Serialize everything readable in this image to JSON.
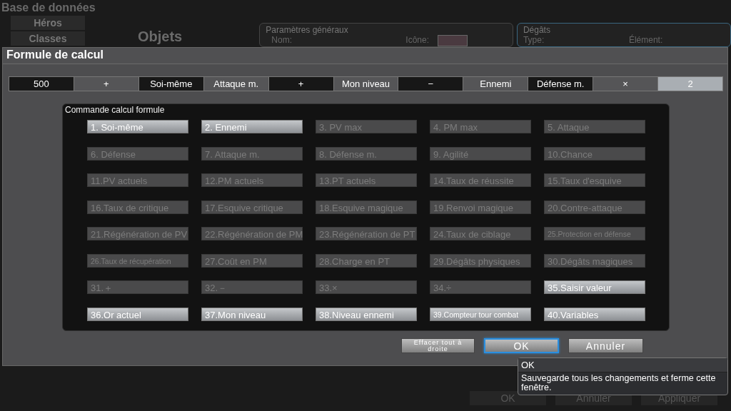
{
  "background": {
    "title": "Base de données",
    "sidebar": [
      {
        "label": "Héros"
      },
      {
        "label": "Classes"
      }
    ],
    "heading": "Objets",
    "general_panel": {
      "title": "Paramètres généraux",
      "name_label": "Nom:",
      "icon_label": "Icône:"
    },
    "damage_panel": {
      "title": "Dégâts",
      "type_label": "Type:",
      "element_label": "Élément:"
    },
    "buttons": [
      "OK",
      "Annuler",
      "Appliquer"
    ]
  },
  "dialog": {
    "title": "Formule de calcul",
    "formula": [
      {
        "text": "500",
        "selected": false
      },
      {
        "text": "+",
        "selected": false
      },
      {
        "text": "Soi-même",
        "selected": false
      },
      {
        "text": "Attaque m.",
        "selected": false
      },
      {
        "text": "+",
        "selected": false
      },
      {
        "text": "Mon niveau",
        "selected": false
      },
      {
        "text": "−",
        "selected": false
      },
      {
        "text": "Ennemi",
        "selected": false
      },
      {
        "text": "Défense m.",
        "selected": false
      },
      {
        "text": "×",
        "selected": false
      },
      {
        "text": "2",
        "selected": true
      }
    ],
    "commands": {
      "title": "Commande calcul formule",
      "items": [
        {
          "label": "1. Soi-même",
          "enabled": true,
          "small": false
        },
        {
          "label": "2. Ennemi",
          "enabled": true,
          "small": false
        },
        {
          "label": "3. PV max",
          "enabled": false,
          "small": false
        },
        {
          "label": "4. PM max",
          "enabled": false,
          "small": false
        },
        {
          "label": "5. Attaque",
          "enabled": false,
          "small": false
        },
        {
          "label": "6. Défense",
          "enabled": false,
          "small": false
        },
        {
          "label": "7. Attaque m.",
          "enabled": false,
          "small": false
        },
        {
          "label": "8. Défense m.",
          "enabled": false,
          "small": false
        },
        {
          "label": "9. Agilité",
          "enabled": false,
          "small": false
        },
        {
          "label": "10.Chance",
          "enabled": false,
          "small": false
        },
        {
          "label": "11.PV actuels",
          "enabled": false,
          "small": false
        },
        {
          "label": "12.PM actuels",
          "enabled": false,
          "small": false
        },
        {
          "label": "13.PT actuels",
          "enabled": false,
          "small": false
        },
        {
          "label": "14.Taux de réussite",
          "enabled": false,
          "small": false
        },
        {
          "label": "15.Taux d'esquive",
          "enabled": false,
          "small": false
        },
        {
          "label": "16.Taux de critique",
          "enabled": false,
          "small": false
        },
        {
          "label": "17.Esquive critique",
          "enabled": false,
          "small": false
        },
        {
          "label": "18.Esquive magique",
          "enabled": false,
          "small": false
        },
        {
          "label": "19.Renvoi magique",
          "enabled": false,
          "small": false
        },
        {
          "label": "20.Contre-attaque",
          "enabled": false,
          "small": false
        },
        {
          "label": "21.Régénération de PV",
          "enabled": false,
          "small": false
        },
        {
          "label": "22.Régénération de PM",
          "enabled": false,
          "small": false
        },
        {
          "label": "23.Régénération de PT",
          "enabled": false,
          "small": false
        },
        {
          "label": "24.Taux de ciblage",
          "enabled": false,
          "small": false
        },
        {
          "label": "25.Protection en défense",
          "enabled": false,
          "small": true
        },
        {
          "label": "26.Taux de récupération",
          "enabled": false,
          "small": true
        },
        {
          "label": "27.Coût en PM",
          "enabled": false,
          "small": false
        },
        {
          "label": "28.Charge en PT",
          "enabled": false,
          "small": false
        },
        {
          "label": "29.Dégâts physiques",
          "enabled": false,
          "small": false
        },
        {
          "label": "30.Dégâts magiques",
          "enabled": false,
          "small": false
        },
        {
          "label": "31.＋",
          "enabled": false,
          "small": false
        },
        {
          "label": "32.－",
          "enabled": false,
          "small": false
        },
        {
          "label": "33.×",
          "enabled": false,
          "small": false
        },
        {
          "label": "34.÷",
          "enabled": false,
          "small": false
        },
        {
          "label": "35.Saisir valeur",
          "enabled": true,
          "small": false
        },
        {
          "label": "36.Or actuel",
          "enabled": true,
          "small": false
        },
        {
          "label": "37.Mon niveau",
          "enabled": true,
          "small": false
        },
        {
          "label": "38.Niveau ennemi",
          "enabled": true,
          "small": false
        },
        {
          "label": "39.Compteur tour combat",
          "enabled": true,
          "small": true
        },
        {
          "label": "40.Variables",
          "enabled": true,
          "small": false
        }
      ]
    },
    "buttons": [
      {
        "label": "Effacer tout à droite",
        "focused": false,
        "small": true
      },
      {
        "label": "OK",
        "focused": true,
        "small": false
      },
      {
        "label": "Annuler",
        "focused": false,
        "small": false
      }
    ]
  },
  "tooltip": {
    "title": "OK",
    "text": "Sauvegarde tous les changements et ferme cette fenêtre."
  }
}
